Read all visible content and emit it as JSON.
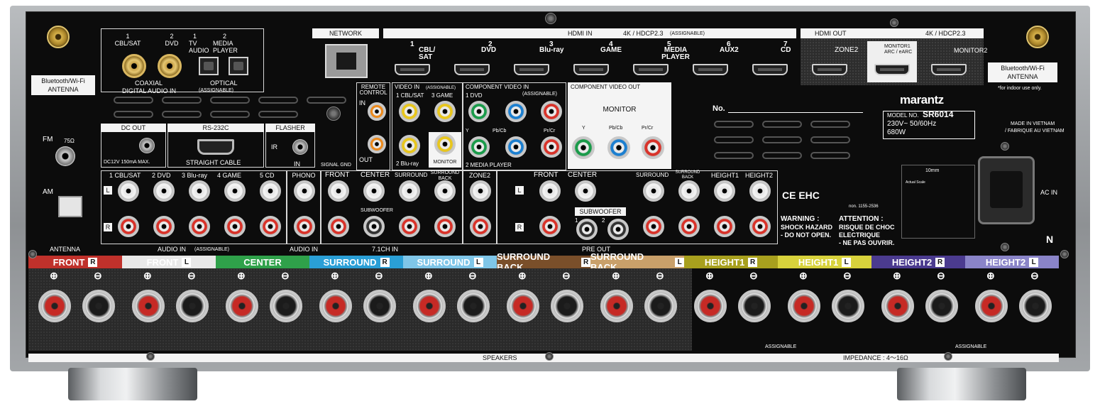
{
  "top": {
    "bt_antenna_left": [
      "Bluetooth/Wi-Fi",
      "ANTENNA"
    ],
    "bt_antenna_right": [
      "Bluetooth/Wi-Fi",
      "ANTENNA"
    ],
    "indoor_note": "*for indoor use only.",
    "digital_audio": {
      "coax_labels": [
        "1",
        "CBL/SAT",
        "2",
        "DVD"
      ],
      "opt_labels": [
        "1",
        "TV AUDIO",
        "2",
        "MEDIA PLAYER"
      ],
      "coaxial": "COAXIAL",
      "optical": "OPTICAL",
      "title": "DIGITAL AUDIO IN",
      "assignable": "(ASSIGNABLE)"
    },
    "network": "NETWORK",
    "hdmi_in": {
      "title": "HDMI IN",
      "spec": "4K / HDCP2.3",
      "assignable": "(ASSIGNABLE)",
      "ports": [
        {
          "num": "1",
          "name": "CBL/ SAT"
        },
        {
          "num": "2",
          "name": "DVD"
        },
        {
          "num": "3",
          "name": "Blu-ray"
        },
        {
          "num": "4",
          "name": "GAME"
        },
        {
          "num": "5",
          "name": "MEDIA PLAYER"
        },
        {
          "num": "6",
          "name": "AUX2"
        },
        {
          "num": "7",
          "name": "CD"
        }
      ]
    },
    "hdmi_out": {
      "title": "HDMI OUT",
      "spec": "4K / HDCP2.3",
      "ports": [
        "ZONE2",
        "MONITOR1 ARC / eARC",
        "MONITOR2"
      ]
    }
  },
  "middle": {
    "remote_control": [
      "REMOTE",
      "CONTROL"
    ],
    "remote_in": "IN",
    "remote_out": "OUT",
    "signal_gnd": "SIGNAL GND",
    "video_in": {
      "title": "VIDEO IN",
      "assignable": "(ASSIGNABLE)",
      "labels": [
        "1 CBL/SAT",
        "3 GAME",
        "2 Blu-ray",
        "MONITOR"
      ]
    },
    "component_in": {
      "title": "COMPONENT VIDEO IN",
      "assignable": "(ASSIGNABLE)",
      "labels": [
        "1 DVD",
        "Y",
        "Pb/Cb",
        "Pr/Cr",
        "2 MEDIA PLAYER"
      ]
    },
    "component_out": {
      "title": "COMPONENT VIDEO OUT",
      "monitor": "MONITOR",
      "labels": [
        "Y",
        "Pb/Cb",
        "Pr/Cr"
      ]
    },
    "dc_out": {
      "title": "DC OUT",
      "spec": "DC12V 150mA MAX."
    },
    "rs232c": {
      "title": "RS-232C",
      "cable": "STRAIGHT CABLE"
    },
    "flasher": {
      "title": "FLASHER",
      "ir": "IR",
      "in": "IN"
    },
    "fm": "FM",
    "fm_ohm": "75Ω",
    "am": "AM",
    "antenna": "ANTENNA",
    "audio_in": {
      "labels": [
        "1 CBL/SAT",
        "2 DVD",
        "3 Blu-ray",
        "4 GAME",
        "5 CD"
      ],
      "title": "AUDIO IN",
      "assignable": "(ASSIGNABLE)"
    },
    "phono": "PHONO",
    "phono_title": "AUDIO IN",
    "ch71": {
      "labels": [
        "FRONT",
        "CENTER",
        "SURROUND",
        "SURROUND BACK",
        "SUBWOOFER"
      ],
      "title": "7.1CH IN"
    },
    "zone2": "ZONE2",
    "pre_out": {
      "labels": [
        "FRONT",
        "CENTER",
        "SURROUND",
        "SURROUND BACK",
        "HEIGHT1",
        "HEIGHT2",
        "SUBWOOFER",
        "1",
        "2"
      ],
      "title": "PRE OUT"
    },
    "lr": [
      "L",
      "R"
    ],
    "brand": "marantz",
    "model_label": "MODEL NO.",
    "model": "SR6014",
    "power_spec": "230V~ 50/60Hz",
    "watt": "680W",
    "no_label": "No.",
    "made_in": [
      "MADE IN VIETNAM",
      "/ FABRIQUE AU VIETNAM"
    ],
    "ac_in": "AC IN",
    "cert": "CE EHC",
    "warning_en": [
      "WARNING :",
      "SHOCK HAZARD",
      "- DO NOT OPEN."
    ],
    "warning_fr": [
      "ATTENTION :",
      "RISQUE DE CHOC",
      "ELECTRIQUE",
      "- NE PAS OUVRIR."
    ],
    "n_mark": "N",
    "scale": {
      "len": "10mm",
      "note": "Actual Scale"
    },
    "reg": "non. 1155-2536"
  },
  "speakers": {
    "channels": [
      {
        "name": "FRONT",
        "side": "R",
        "color": "#c0312b",
        "text": "#ffffff"
      },
      {
        "name": "FRONT",
        "side": "L",
        "color": "#e8e8e8",
        "text": "#ffffff"
      },
      {
        "name": "CENTER",
        "side": "",
        "color": "#2fa14a",
        "text": "#ffffff"
      },
      {
        "name": "SURROUND",
        "side": "R",
        "color": "#2a9fd6",
        "text": "#ffffff"
      },
      {
        "name": "SURROUND",
        "side": "L",
        "color": "#7fc6e8",
        "text": "#ffffff"
      },
      {
        "name": "SURROUND BACK",
        "side": "R",
        "color": "#7a4f2a",
        "text": "#ffffff"
      },
      {
        "name": "SURROUND BACK",
        "side": "L",
        "color": "#c9a06a",
        "text": "#ffffff"
      },
      {
        "name": "HEIGHT1",
        "side": "R",
        "color": "#a8a01e",
        "text": "#ffffff"
      },
      {
        "name": "HEIGHT1",
        "side": "L",
        "color": "#d8d23c",
        "text": "#ffffff"
      },
      {
        "name": "HEIGHT2",
        "side": "R",
        "color": "#4b3b8f",
        "text": "#ffffff"
      },
      {
        "name": "HEIGHT2",
        "side": "L",
        "color": "#8a84c8",
        "text": "#ffffff"
      }
    ],
    "plus": "⊕",
    "minus": "⊖",
    "assignable": "ASSIGNABLE",
    "footer": "SPEAKERS",
    "impedance": "IMPEDANCE : 4～16Ω"
  }
}
